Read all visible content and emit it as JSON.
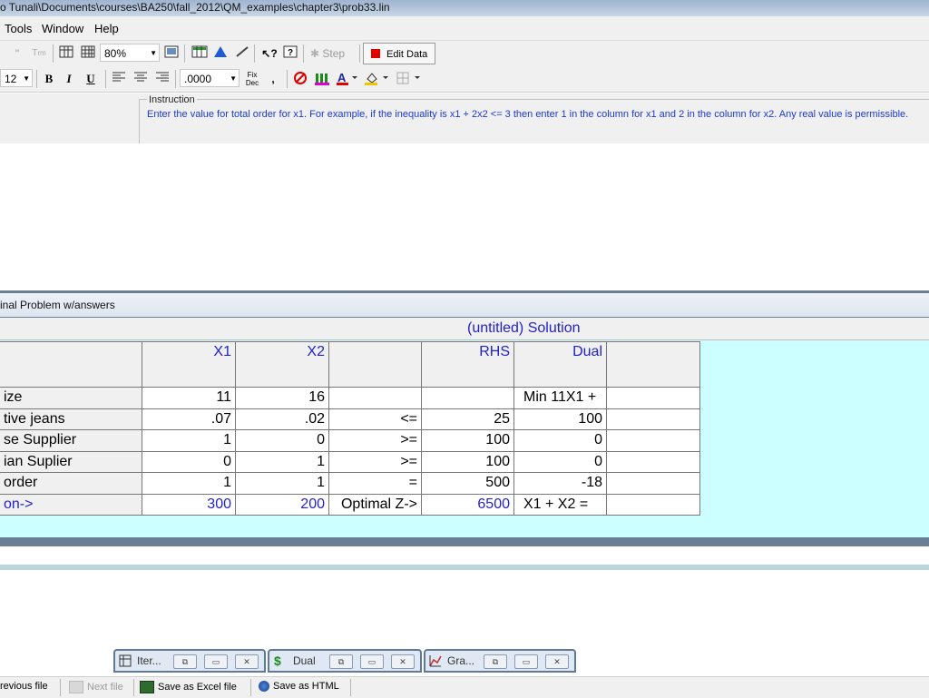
{
  "window": {
    "title": "o Tunali\\Documents\\courses\\BA250\\fall_2012\\QM_examples\\chapter3\\prob33.lin"
  },
  "menu": {
    "items": [
      "Tools",
      "Window",
      "Help"
    ]
  },
  "toolbar1": {
    "zoom": "80%",
    "step_label": "Step",
    "edit_data_label": "Edit Data",
    "t_glyph": "T",
    "dq_glyph": "\""
  },
  "toolbar2": {
    "font_size": "12",
    "number_format": ".0000",
    "bold": "B",
    "italic": "I",
    "underline": "U",
    "fix_dec": "Fix Dec"
  },
  "instruction": {
    "title": "Instruction",
    "text": "Enter the value for total order for x1. For example, if the inequality is x1 + 2x2 <= 3 then enter 1 in the column for x1 and 2 in the column for x2. Any real value is permissible."
  },
  "solution": {
    "window_title": "inal Problem w/answers",
    "header": "(untitled) Solution",
    "columns": [
      "",
      "X1",
      "X2",
      "",
      "RHS",
      "Dual",
      ""
    ],
    "rows": [
      [
        "ize",
        "11",
        "16",
        "",
        "",
        "Min  11X1 +",
        ""
      ],
      [
        "tive jeans",
        ".07",
        ".02",
        "<=",
        "25",
        "100",
        ""
      ],
      [
        "se Supplier",
        "1",
        "0",
        ">=",
        "100",
        "0",
        ""
      ],
      [
        "ian Suplier",
        "0",
        "1",
        ">=",
        "100",
        "0",
        ""
      ],
      [
        "order",
        "1",
        "1",
        "=",
        "500",
        "-18",
        ""
      ],
      [
        "on->",
        "300",
        "200",
        "Optimal Z->",
        "6500",
        "X1 + X2 =",
        ""
      ]
    ]
  },
  "minimized_windows": [
    {
      "label": "Iter...",
      "icon": "table-icon"
    },
    {
      "label": "Dual",
      "icon": "dollar-icon"
    },
    {
      "label": "Gra...",
      "icon": "graph-icon"
    }
  ],
  "statusbar": {
    "previous_file": "revious file",
    "next_file": "Next file",
    "save_excel": "Save as Excel file",
    "save_html": "Save as HTML"
  },
  "colors": {
    "accent_blue": "#2222cc",
    "solution_bg": "#ccffff",
    "edit_data_red": "#e00000"
  }
}
